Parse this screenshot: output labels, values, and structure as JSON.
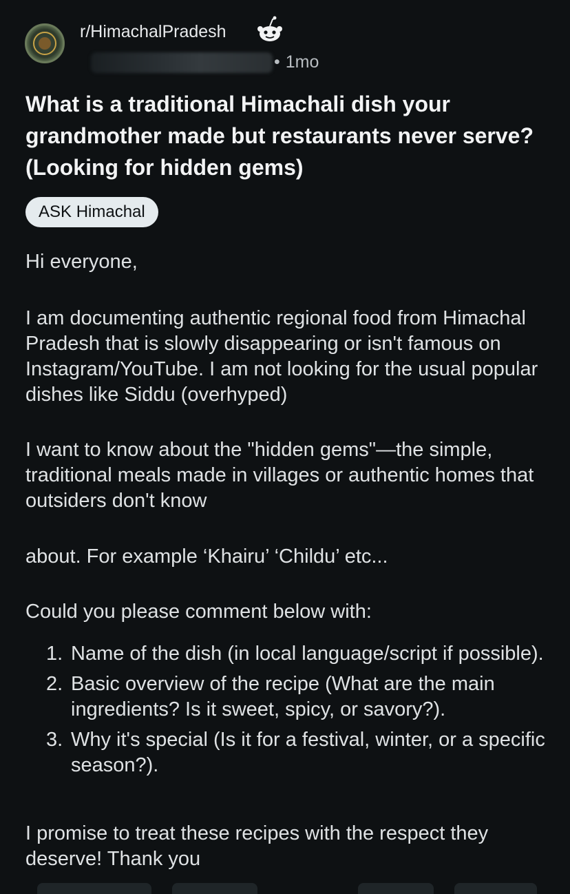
{
  "header": {
    "subreddit": "r/HimachalPradesh",
    "separator": "•",
    "age": "1mo",
    "icons": [
      "subreddit-avatar",
      "snoo-icon"
    ]
  },
  "post": {
    "title": "What is a traditional Himachali dish your grandmother made but restaurants never serve? (Looking for hidden gems)",
    "flair": "ASK Himachal",
    "greeting": "Hi everyone,",
    "documenting": "I am documenting authentic regional food from Himachal Pradesh that is slowly disappearing or isn't famous on Instagram/YouTube. I am not looking for the usual popular dishes like Siddu (overhyped)",
    "want": "I want to know about the \"hidden gems\"—the simple, traditional meals made in villages or authentic homes that outsiders don't know",
    "about": "about. For example ‘Khairu’ ‘Childu’ etc...",
    "could": "Could you please comment below with:",
    "list": [
      {
        "num": "1.",
        "text": "Name of the dish (in local language/script if possible)."
      },
      {
        "num": "2.",
        "text": "Basic overview of the recipe (What are the main ingredients? Is it sweet, spicy, or savory?)."
      },
      {
        "num": "3.",
        "text": "Why it's special (Is it for a festival, winter, or a specific season?)."
      }
    ],
    "promise": "I promise to treat these recipes with the respect they deserve! Thank you"
  },
  "colors": {
    "background": "#0e1113",
    "text": "#dfe2e4",
    "flair_bg": "#e5ebee",
    "meta": "#b8bdc1"
  }
}
